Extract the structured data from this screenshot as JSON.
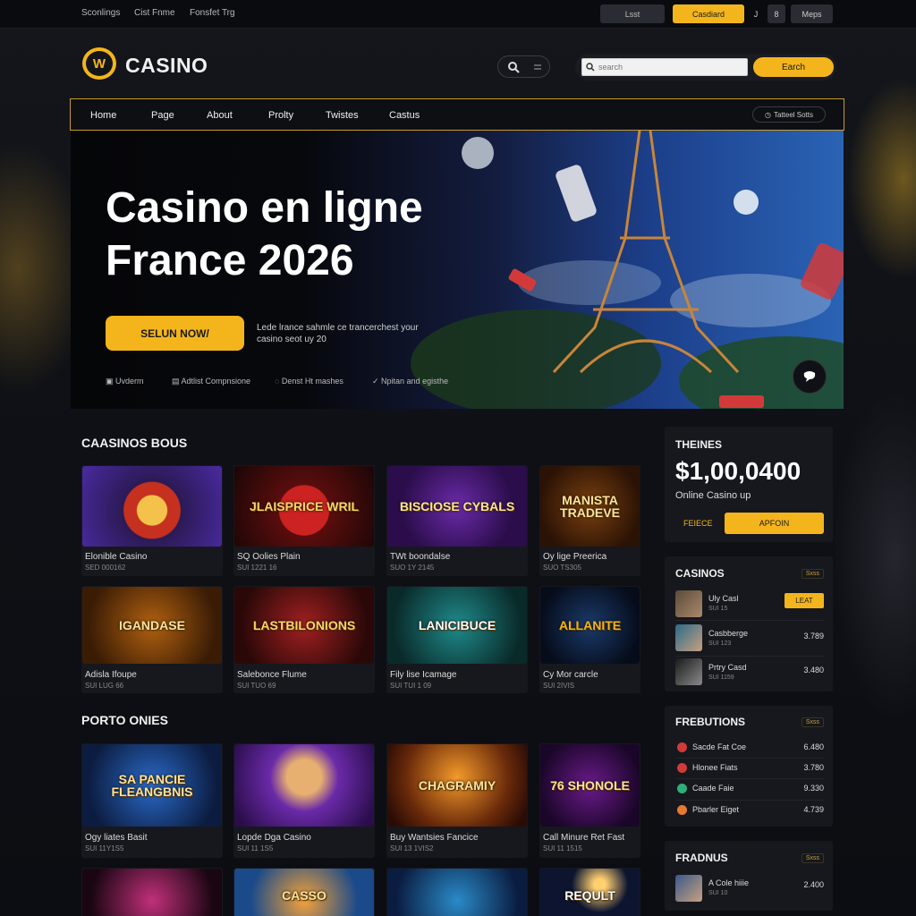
{
  "topbar": {
    "links": [
      "Sconlings",
      "Cist Fnme",
      "Fonsfet Trg"
    ],
    "btn_dark": "Lsst",
    "btn_gold": "Casdiard",
    "mini": "J",
    "mini2": "8",
    "last": "Meps"
  },
  "header": {
    "logo_glyph": "W",
    "logo_text": "CASINO",
    "search_placeholder": "search",
    "search_btn": "Earch"
  },
  "nav": {
    "items": [
      "Home",
      "Page",
      "About",
      "Prolty",
      "Twistes",
      "Castus"
    ],
    "badge": "Tatteel Sotts"
  },
  "hero": {
    "title": "Casino en ligne France 2026",
    "cta": "SELUN NOW/",
    "sub": "Lede lrance sahmle ce trancerchest your casino seot uy 20",
    "features": [
      "Uvderm",
      "Adtlist Compnsione",
      "Denst Ht mashes",
      "Npitan and egisthe"
    ]
  },
  "section1": {
    "title": "CAASINOS BOUS",
    "cards": [
      {
        "img": "",
        "title": "Elonible Casino",
        "sub": "SED 000162"
      },
      {
        "img": "JLAISPRICE WRIL",
        "title": "SQ Oolies Plain",
        "sub": "SUI 1221 16"
      },
      {
        "img": "BISCIOSE CYBALS",
        "title": "TWt boondalse",
        "sub": "SUO 1Y 2145"
      },
      {
        "img": "MANISTA TRADEVE",
        "title": "Oy lige Preerica",
        "sub": "SUO TS305"
      },
      {
        "img": "IGANDASE",
        "title": "Adisla Ifoupe",
        "sub": "SUI LUG 66"
      },
      {
        "img": "LASTBILONIONS",
        "title": "Salebonce Flume",
        "sub": "SUI TUO 69"
      },
      {
        "img": "LANICIBUCE",
        "title": "Fily lise Icamage",
        "sub": "SUI TUI 1 09"
      },
      {
        "img": "ALLANITE",
        "title": "Cy Mor carcle",
        "sub": "SUI 2IVIS"
      }
    ]
  },
  "section2": {
    "title": "PORTO ONIES",
    "cards": [
      {
        "img": "SA PANCIE FLEANGBNIS",
        "title": "Ogy liates Basit",
        "sub": "SUI 11Y1S5"
      },
      {
        "img": "",
        "title": "Lopde Dga Casino",
        "sub": "SUI 11 1S5"
      },
      {
        "img": "CHAGRAMIY",
        "title": "Buy Wantsies Fancice",
        "sub": "SUI 13 1VIS2"
      },
      {
        "img": "76 SHONOLE",
        "title": "Call Minure Ret Fast",
        "sub": "SUI 11 1515"
      },
      {
        "img": "",
        "title": "",
        "sub": ""
      },
      {
        "img": "CASSO",
        "title": "",
        "sub": ""
      },
      {
        "img": "",
        "title": "",
        "sub": ""
      },
      {
        "img": "REQULT",
        "title": "",
        "sub": ""
      }
    ]
  },
  "jackpot": {
    "title": "THEINES",
    "amount": "$1,00,0400",
    "sub": "Online Casino up",
    "link": "FEIECE",
    "btn": "APFOIN"
  },
  "casinos": {
    "title": "CASINOS",
    "tag": "Sxss",
    "rows": [
      {
        "name": "Uly Casl",
        "sub": "SUI 15",
        "val": "LEAT"
      },
      {
        "name": "Casbberge",
        "sub": "SUI 123",
        "val": "3.789"
      },
      {
        "name": "Prtry Casd",
        "sub": "SUI 1159",
        "val": "3.480"
      }
    ]
  },
  "freb": {
    "title": "FREBUTIONS",
    "tag": "Sxss",
    "rows": [
      {
        "name": "Sacde Fat Coe",
        "val": "6.480",
        "color": "#d23a3a"
      },
      {
        "name": "Hlonee Fiats",
        "val": "3.780",
        "color": "#d23a3a"
      },
      {
        "name": "Caade Faie",
        "val": "9.330",
        "color": "#2fae7a"
      },
      {
        "name": "Pbarler Eiget",
        "val": "4.739",
        "color": "#e6792e"
      }
    ]
  },
  "fradnus": {
    "title": "FRADNUS",
    "tag": "Sxss",
    "rows": [
      {
        "name": "A Cole hiiie",
        "sub": "SUI 10",
        "val": "2.400"
      }
    ]
  }
}
